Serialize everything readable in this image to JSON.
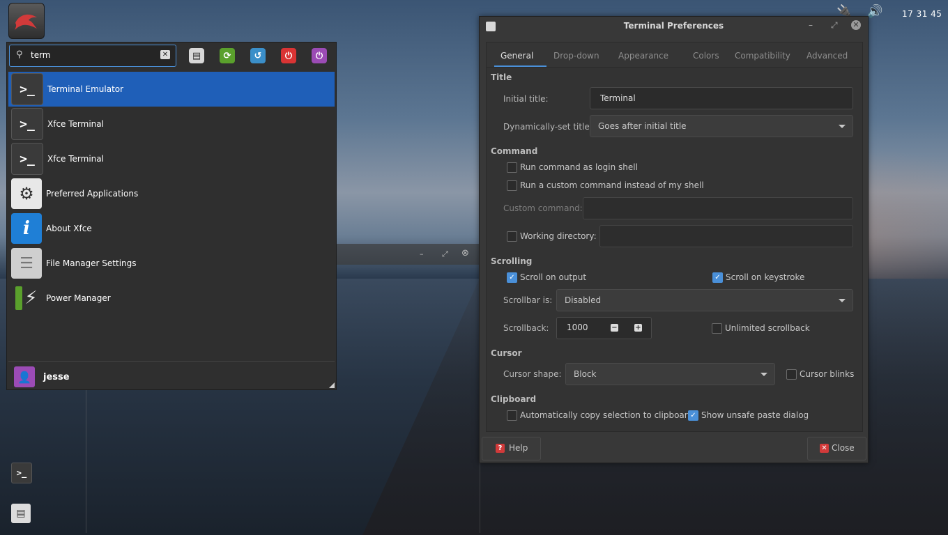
{
  "tray": {
    "clock": "17 31 45"
  },
  "menu": {
    "search": {
      "value": "term",
      "placeholder": ""
    },
    "results": [
      {
        "label": "Terminal Emulator",
        "icon": "terminal-icon",
        "selected": true
      },
      {
        "label": "Xfce Terminal",
        "icon": "terminal-icon"
      },
      {
        "label": "Xfce Terminal",
        "icon": "terminal-icon"
      },
      {
        "label": "Preferred Applications",
        "icon": "gear-icon"
      },
      {
        "label": "About Xfce",
        "icon": "info-icon"
      },
      {
        "label": "File Manager Settings",
        "icon": "file-cabinet-icon"
      },
      {
        "label": "Power Manager",
        "icon": "battery-icon"
      }
    ],
    "user": "jesse"
  },
  "window": {
    "title": "Terminal Preferences",
    "tabs": [
      "General",
      "Drop-down",
      "Appearance",
      "Colors",
      "Compatibility",
      "Advanced"
    ],
    "active_tab": "General",
    "title_section": {
      "heading": "Title",
      "initial_title_label": "Initial title:",
      "initial_title_value": "Terminal",
      "dynamic_label": "Dynamically-set title:",
      "dynamic_value": "Goes after initial title"
    },
    "command": {
      "heading": "Command",
      "login_shell": "Run command as login shell",
      "custom_cmd": "Run a custom command instead of my shell",
      "custom_cmd_label": "Custom command:",
      "working_dir": "Working directory:"
    },
    "scrolling": {
      "heading": "Scrolling",
      "on_output": "Scroll on output",
      "on_keystroke": "Scroll on keystroke",
      "scrollbar_label": "Scrollbar is:",
      "scrollbar_value": "Disabled",
      "scrollback_label": "Scrollback:",
      "scrollback_value": "1000",
      "unlimited": "Unlimited scrollback"
    },
    "cursor": {
      "heading": "Cursor",
      "shape_label": "Cursor shape:",
      "shape_value": "Block",
      "blinks": "Cursor blinks"
    },
    "clipboard": {
      "heading": "Clipboard",
      "auto_copy": "Automatically copy selection to clipboard",
      "unsafe_paste": "Show unsafe paste dialog"
    },
    "buttons": {
      "help": "Help",
      "close": "Close"
    }
  },
  "colors": {
    "accent": "#4a90d9",
    "selection": "#1f5fb8"
  }
}
